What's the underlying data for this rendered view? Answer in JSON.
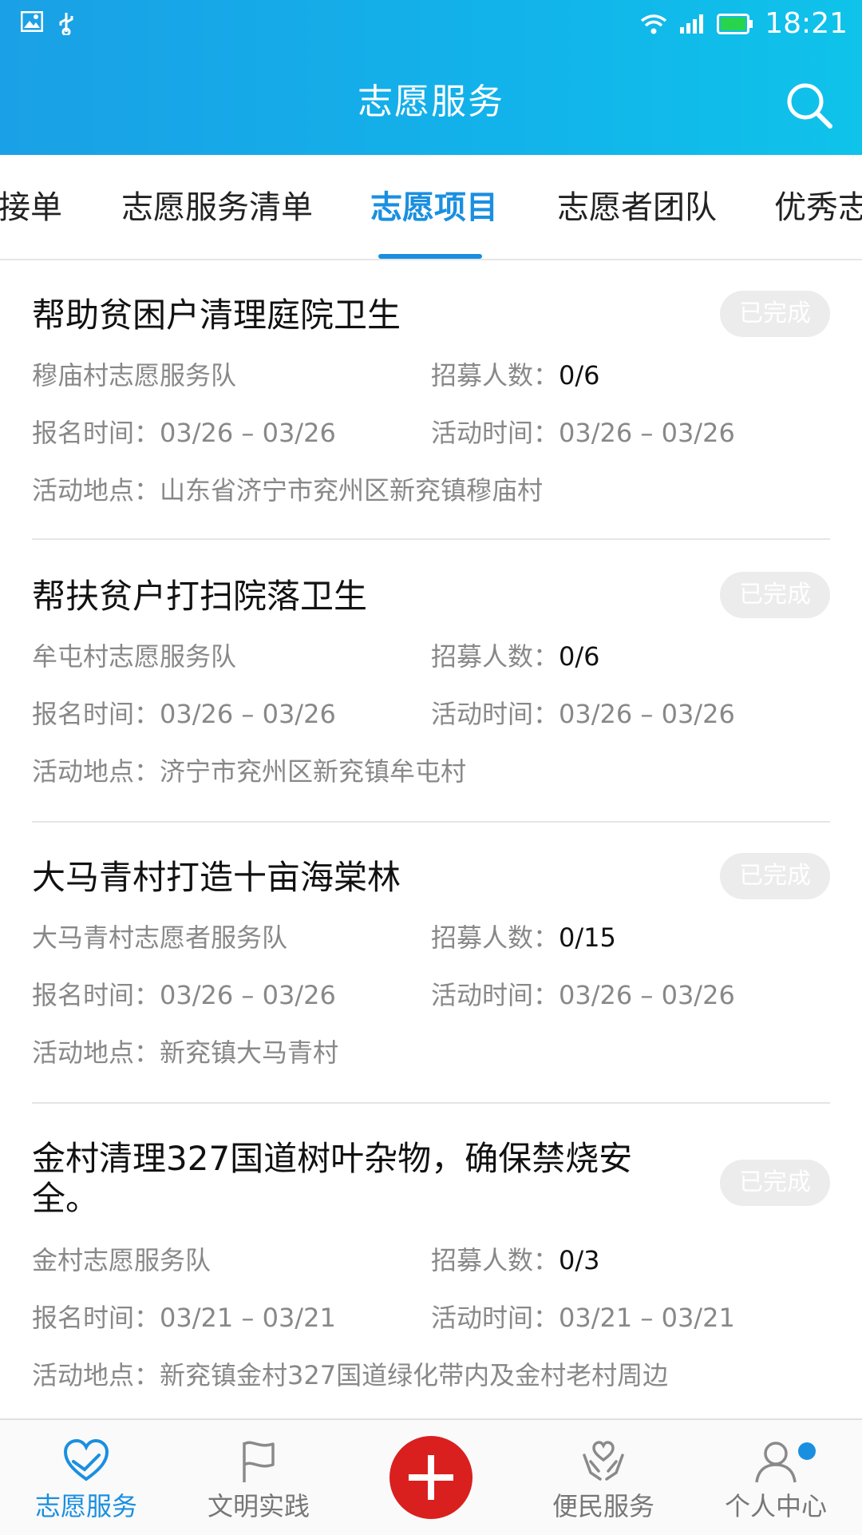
{
  "status_bar": {
    "time": "18:21"
  },
  "header": {
    "title": "志愿服务"
  },
  "tabs": [
    {
      "label": "接单"
    },
    {
      "label": "志愿服务清单"
    },
    {
      "label": "志愿项目"
    },
    {
      "label": "志愿者团队"
    },
    {
      "label": "优秀志"
    }
  ],
  "active_tab": "志愿项目",
  "labels": {
    "recruit": "招募人数：",
    "signup": "报名时间：",
    "activity": "活动时间：",
    "location": "活动地点："
  },
  "items": [
    {
      "title": "帮助贫困户清理庭院卫生",
      "status": "已完成",
      "team": "穆庙村志愿服务队",
      "recruit": "0/6",
      "signup_time": "03/26 – 03/26",
      "activity_time": "03/26 – 03/26",
      "location": "山东省济宁市兖州区新兖镇穆庙村"
    },
    {
      "title": "帮扶贫户打扫院落卫生",
      "status": "已完成",
      "team": "牟屯村志愿服务队",
      "recruit": "0/6",
      "signup_time": "03/26 – 03/26",
      "activity_time": "03/26 – 03/26",
      "location": "济宁市兖州区新兖镇牟屯村"
    },
    {
      "title": "大马青村打造十亩海棠林",
      "status": "已完成",
      "team": "大马青村志愿者服务队",
      "recruit": "0/15",
      "signup_time": "03/26 – 03/26",
      "activity_time": "03/26 – 03/26",
      "location": "新兖镇大马青村"
    },
    {
      "title": "金村清理327国道树叶杂物，确保禁烧安全。",
      "status": "已完成",
      "team": "金村志愿服务队",
      "recruit": "0/3",
      "signup_time": "03/21 – 03/21",
      "activity_time": "03/21 – 03/21",
      "location": "新兖镇金村327国道绿化带内及金村老村周边"
    }
  ],
  "bottom_nav": [
    {
      "label": "志愿服务",
      "icon": "heart-hands-icon"
    },
    {
      "label": "文明实践",
      "icon": "flag-icon"
    },
    {
      "label": "",
      "icon": "plus-icon"
    },
    {
      "label": "便民服务",
      "icon": "heart-support-icon"
    },
    {
      "label": "个人中心",
      "icon": "user-icon"
    }
  ],
  "colors": {
    "accent": "#1a8fe0",
    "header": "#12b3ea",
    "fab": "#d9201f"
  }
}
